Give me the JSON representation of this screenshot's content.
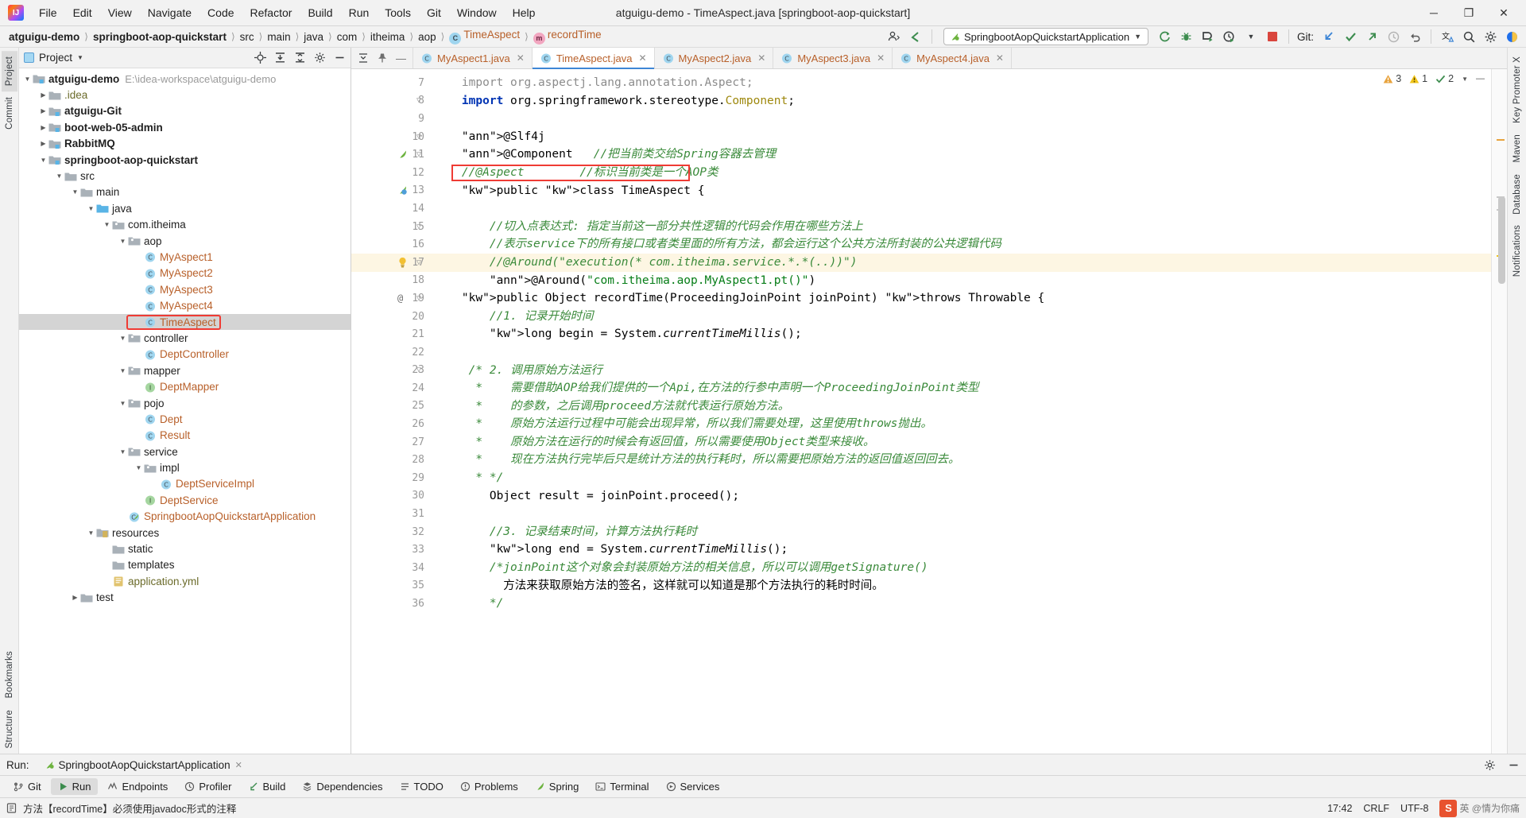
{
  "window": {
    "title": "atguigu-demo - TimeAspect.java [springboot-aop-quickstart]",
    "minimize": "─",
    "maximize": "❐",
    "close": "✕"
  },
  "menu": [
    "File",
    "Edit",
    "View",
    "Navigate",
    "Code",
    "Refactor",
    "Build",
    "Run",
    "Tools",
    "Git",
    "Window",
    "Help"
  ],
  "breadcrumbs": [
    {
      "label": "atguigu-demo",
      "bold": true,
      "icon": ""
    },
    {
      "label": "springboot-aop-quickstart",
      "bold": true,
      "icon": ""
    },
    {
      "label": "src",
      "bold": false,
      "icon": ""
    },
    {
      "label": "main",
      "bold": false,
      "icon": ""
    },
    {
      "label": "java",
      "bold": false,
      "icon": ""
    },
    {
      "label": "com",
      "bold": false,
      "icon": ""
    },
    {
      "label": "itheima",
      "bold": false,
      "icon": ""
    },
    {
      "label": "aop",
      "bold": false,
      "icon": ""
    },
    {
      "label": "TimeAspect",
      "bold": false,
      "icon": "class-icon",
      "orange": true
    },
    {
      "label": "recordTime",
      "bold": false,
      "icon": "method-icon",
      "orange": true
    }
  ],
  "toolbar": {
    "run_configuration": "SpringbootAopQuickstartApplication",
    "git_label": "Git:",
    "icons": [
      "profile-icon",
      "back-arrow-icon",
      "rerun-icon",
      "debug-icon",
      "coverage-icon",
      "profiler-run-icon",
      "dropdown-icon",
      "stop-icon",
      "git-update-icon",
      "git-commit-icon",
      "git-push-icon",
      "git-history-icon",
      "git-rollback-icon",
      "translate-icon",
      "search-icon",
      "settings-icon",
      "ide-icon"
    ]
  },
  "left_rail": [
    "Project",
    "Commit"
  ],
  "left_rail_bottom": [
    "Bookmarks",
    "Structure"
  ],
  "right_rail": [
    "Key Promoter X",
    "Maven",
    "Database",
    "Notifications"
  ],
  "project_panel": {
    "title": "Project",
    "header_icons": [
      "locate-icon",
      "expand-all-icon",
      "collapse-all-icon",
      "settings-icon",
      "hide-icon"
    ],
    "tree": [
      {
        "depth": 0,
        "label": "atguigu-demo",
        "type": "module",
        "bold": true,
        "arrow": "down",
        "path": "E:\\idea-workspace\\atguigu-demo"
      },
      {
        "depth": 1,
        "label": ".idea",
        "type": "folder-gray",
        "olive": true,
        "arrow": "right"
      },
      {
        "depth": 1,
        "label": "atguigu-Git",
        "type": "module",
        "bold": true,
        "arrow": "right"
      },
      {
        "depth": 1,
        "label": "boot-web-05-admin",
        "type": "module",
        "bold": true,
        "arrow": "right"
      },
      {
        "depth": 1,
        "label": "RabbitMQ",
        "type": "module",
        "bold": true,
        "arrow": "right"
      },
      {
        "depth": 1,
        "label": "springboot-aop-quickstart",
        "type": "module",
        "bold": true,
        "arrow": "down"
      },
      {
        "depth": 2,
        "label": "src",
        "type": "folder-gray",
        "arrow": "down"
      },
      {
        "depth": 3,
        "label": "main",
        "type": "folder-gray",
        "arrow": "down"
      },
      {
        "depth": 4,
        "label": "java",
        "type": "folder-source",
        "arrow": "down"
      },
      {
        "depth": 5,
        "label": "com.itheima",
        "type": "package",
        "arrow": "down"
      },
      {
        "depth": 6,
        "label": "aop",
        "type": "package",
        "arrow": "down"
      },
      {
        "depth": 7,
        "label": "MyAspect1",
        "type": "class",
        "arrow": "none"
      },
      {
        "depth": 7,
        "label": "MyAspect2",
        "type": "class",
        "arrow": "none"
      },
      {
        "depth": 7,
        "label": "MyAspect3",
        "type": "class",
        "arrow": "none"
      },
      {
        "depth": 7,
        "label": "MyAspect4",
        "type": "class",
        "arrow": "none"
      },
      {
        "depth": 7,
        "label": "TimeAspect",
        "type": "class",
        "arrow": "none",
        "selected": true,
        "highlight": true
      },
      {
        "depth": 6,
        "label": "controller",
        "type": "package",
        "arrow": "down"
      },
      {
        "depth": 7,
        "label": "DeptController",
        "type": "class",
        "arrow": "none"
      },
      {
        "depth": 6,
        "label": "mapper",
        "type": "package",
        "arrow": "down"
      },
      {
        "depth": 7,
        "label": "DeptMapper",
        "type": "interface",
        "arrow": "none"
      },
      {
        "depth": 6,
        "label": "pojo",
        "type": "package",
        "arrow": "down"
      },
      {
        "depth": 7,
        "label": "Dept",
        "type": "class",
        "arrow": "none"
      },
      {
        "depth": 7,
        "label": "Result",
        "type": "class",
        "arrow": "none"
      },
      {
        "depth": 6,
        "label": "service",
        "type": "package",
        "arrow": "down"
      },
      {
        "depth": 7,
        "label": "impl",
        "type": "package",
        "arrow": "down"
      },
      {
        "depth": 8,
        "label": "DeptServiceImpl",
        "type": "class",
        "arrow": "none"
      },
      {
        "depth": 7,
        "label": "DeptService",
        "type": "interface",
        "arrow": "none"
      },
      {
        "depth": 6,
        "label": "SpringbootAopQuickstartApplication",
        "type": "spring-class",
        "arrow": "none"
      },
      {
        "depth": 4,
        "label": "resources",
        "type": "folder-resource",
        "arrow": "down"
      },
      {
        "depth": 5,
        "label": "static",
        "type": "folder-gray",
        "arrow": "none"
      },
      {
        "depth": 5,
        "label": "templates",
        "type": "folder-gray",
        "arrow": "none"
      },
      {
        "depth": 5,
        "label": "application.yml",
        "type": "yml",
        "olive": true,
        "arrow": "none"
      },
      {
        "depth": 3,
        "label": "test",
        "type": "folder-gray",
        "arrow": "right"
      }
    ]
  },
  "editor_tabs": [
    {
      "label": "MyAspect1.java",
      "active": false
    },
    {
      "label": "TimeAspect.java",
      "active": true
    },
    {
      "label": "MyAspect2.java",
      "active": false
    },
    {
      "label": "MyAspect3.java",
      "active": false
    },
    {
      "label": "MyAspect4.java",
      "active": false
    }
  ],
  "inspection_widget": {
    "errors": "3",
    "warnings": "1",
    "checks": "2",
    "error_icon": "error-triangle-icon",
    "warning_icon": "warning-triangle-icon",
    "check_icon": "check-icon",
    "chevron": "chevron-down-icon"
  },
  "code": {
    "first_line_number": 7,
    "lines": [
      {
        "n": 7,
        "text": "    import org.aspectj.lang.annotation.Aspect;"
      },
      {
        "n": 8,
        "text": "    import org.springframework.stereotype.Component;"
      },
      {
        "n": 9,
        "text": ""
      },
      {
        "n": 10,
        "text": "    @Slf4j"
      },
      {
        "n": 11,
        "text": "    @Component   //把当前类交给Spring容器去管理"
      },
      {
        "n": 12,
        "text": "    //@Aspect        //标识当前类是一个AOP类"
      },
      {
        "n": 13,
        "text": "    public class TimeAspect {"
      },
      {
        "n": 14,
        "text": ""
      },
      {
        "n": 15,
        "text": "        //切入点表达式: 指定当前这一部分共性逻辑的代码会作用在哪些方法上"
      },
      {
        "n": 16,
        "text": "        //表示service下的所有接口或者类里面的所有方法，都会运行这个公共方法所封装的公共逻辑代码"
      },
      {
        "n": 17,
        "text": "        //@Around(\"execution(* com.itheima.service.*.*(..))\")"
      },
      {
        "n": 18,
        "text": "        @Around(\"com.itheima.aop.MyAspect1.pt()\")"
      },
      {
        "n": 19,
        "text": "    public Object recordTime(ProceedingJoinPoint joinPoint) throws Throwable {"
      },
      {
        "n": 20,
        "text": "        //1. 记录开始时间"
      },
      {
        "n": 21,
        "text": "        long begin = System.currentTimeMillis();"
      },
      {
        "n": 22,
        "text": ""
      },
      {
        "n": 23,
        "text": "     /* 2. 调用原始方法运行"
      },
      {
        "n": 24,
        "text": "      *    需要借助AOP给我们提供的一个Api,在方法的行参中声明一个ProceedingJoinPoint类型"
      },
      {
        "n": 25,
        "text": "      *    的参数，之后调用proceed方法就代表运行原始方法。"
      },
      {
        "n": 26,
        "text": "      *    原始方法运行过程中可能会出现异常，所以我们需要处理，这里使用throws抛出。"
      },
      {
        "n": 27,
        "text": "      *    原始方法在运行的时候会有返回值，所以需要使用Object类型来接收。"
      },
      {
        "n": 28,
        "text": "      *    现在方法执行完毕后只是统计方法的执行耗时，所以需要把原始方法的返回值返回回去。"
      },
      {
        "n": 29,
        "text": "      * */"
      },
      {
        "n": 30,
        "text": "        Object result = joinPoint.proceed();"
      },
      {
        "n": 31,
        "text": ""
      },
      {
        "n": 32,
        "text": "        //3. 记录结束时间，计算方法执行耗时"
      },
      {
        "n": 33,
        "text": "        long end = System.currentTimeMillis();"
      },
      {
        "n": 34,
        "text": "        /*joinPoint这个对象会封装原始方法的相关信息，所以可以调用getSignature()"
      },
      {
        "n": 35,
        "text": "          方法来获取原始方法的签名，这样就可以知道是那个方法执行的耗时时间。"
      },
      {
        "n": 36,
        "text": "        */"
      }
    ]
  },
  "run_panel": {
    "label": "Run:",
    "config_name": "SpringbootAopQuickstartApplication",
    "close_icon": "close-icon",
    "settings_icon": "settings-icon",
    "hide_icon": "hide-icon"
  },
  "bottom_toolwindows": [
    {
      "label": "Git",
      "icon": "git-icon",
      "selected": false
    },
    {
      "label": "Run",
      "icon": "run-icon",
      "selected": true
    },
    {
      "label": "Endpoints",
      "icon": "endpoints-icon",
      "selected": false
    },
    {
      "label": "Profiler",
      "icon": "profiler-icon",
      "selected": false
    },
    {
      "label": "Build",
      "icon": "build-icon",
      "selected": false
    },
    {
      "label": "Dependencies",
      "icon": "dependencies-icon",
      "selected": false
    },
    {
      "label": "TODO",
      "icon": "todo-icon",
      "selected": false
    },
    {
      "label": "Problems",
      "icon": "problems-icon",
      "selected": false
    },
    {
      "label": "Spring",
      "icon": "spring-icon",
      "selected": false
    },
    {
      "label": "Terminal",
      "icon": "terminal-icon",
      "selected": false
    },
    {
      "label": "Services",
      "icon": "services-icon",
      "selected": false
    }
  ],
  "status_bar": {
    "message": "方法【recordTime】必须使用javadoc形式的注释",
    "message_icon": "info-icon",
    "time": "17:42",
    "line_separator": "CRLF",
    "encoding": "UTF-8",
    "watermark": "英 @情为你痛",
    "watermark_badge": "S"
  },
  "colors": {
    "accent_blue": "#3e86d6",
    "highlight_red": "#ef3b34",
    "class_orange": "#b8602a",
    "comment_green": "#3a8a3a",
    "keyword_blue": "#0033b3",
    "string_green": "#067d17",
    "annotation_yellow": "#9e880d",
    "selection_gray": "#d4d4d4"
  }
}
